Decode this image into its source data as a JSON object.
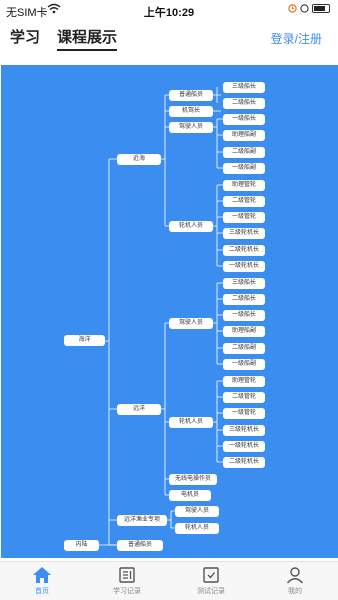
{
  "status_bar": {
    "carrier": "无SIM卡",
    "time": "上午10:29",
    "icons": [
      "wifi-icon",
      "alarm-icon",
      "battery-icon"
    ]
  },
  "header": {
    "tabs": [
      {
        "label": "学习"
      },
      {
        "label": "课程展示"
      }
    ],
    "login_label": "登录/注册"
  },
  "mindmap": {
    "root": {
      "label": "海洋"
    },
    "near": {
      "label": "近海",
      "crew": {
        "label": "普通船员",
        "items": [
          "三级船长"
        ]
      },
      "captain": {
        "label": "机驾长",
        "items": [
          "二级船长"
        ]
      },
      "driver": {
        "label": "驾驶人员",
        "items": [
          "一级船长",
          "助理船副",
          "二级船副",
          "一级船副"
        ]
      },
      "engine": {
        "label": "轮机人员",
        "items": [
          "助理管轮",
          "二级管轮",
          "一级管轮",
          "三级轮机长",
          "二级轮机长",
          "一级轮机长"
        ]
      }
    },
    "far": {
      "label": "远洋",
      "driver": {
        "label": "驾驶人员",
        "items": [
          "三级船长",
          "二级船长",
          "一级船长",
          "助理船副",
          "二级船副",
          "一级船副"
        ]
      },
      "engine": {
        "label": "轮机人员",
        "items": [
          "助理管轮",
          "二级管轮",
          "一级管轮",
          "三级轮机长",
          "一级轮机长",
          "二级轮机长"
        ]
      },
      "radio": {
        "label": "无线电操作员"
      },
      "electric": {
        "label": "电机员"
      }
    },
    "fishing": {
      "label": "远洋渔业专项",
      "items": [
        "驾驶人员",
        "轮机人员"
      ]
    },
    "inland": {
      "label": "内陆",
      "items": [
        "普通船员"
      ]
    }
  },
  "tabbar": {
    "items": [
      {
        "label": "首页",
        "icon": "home-icon",
        "active": true
      },
      {
        "label": "学习记录",
        "icon": "study-record-icon",
        "active": false
      },
      {
        "label": "测试记录",
        "icon": "test-record-icon",
        "active": false
      },
      {
        "label": "我的",
        "icon": "profile-icon",
        "active": false
      }
    ],
    "active_color": "#3d8ef0",
    "inactive_color": "#888888"
  },
  "colors": {
    "canvas_background": "#3b8ef0",
    "node_background": "#ffffff",
    "accent": "#3d8ef0"
  }
}
